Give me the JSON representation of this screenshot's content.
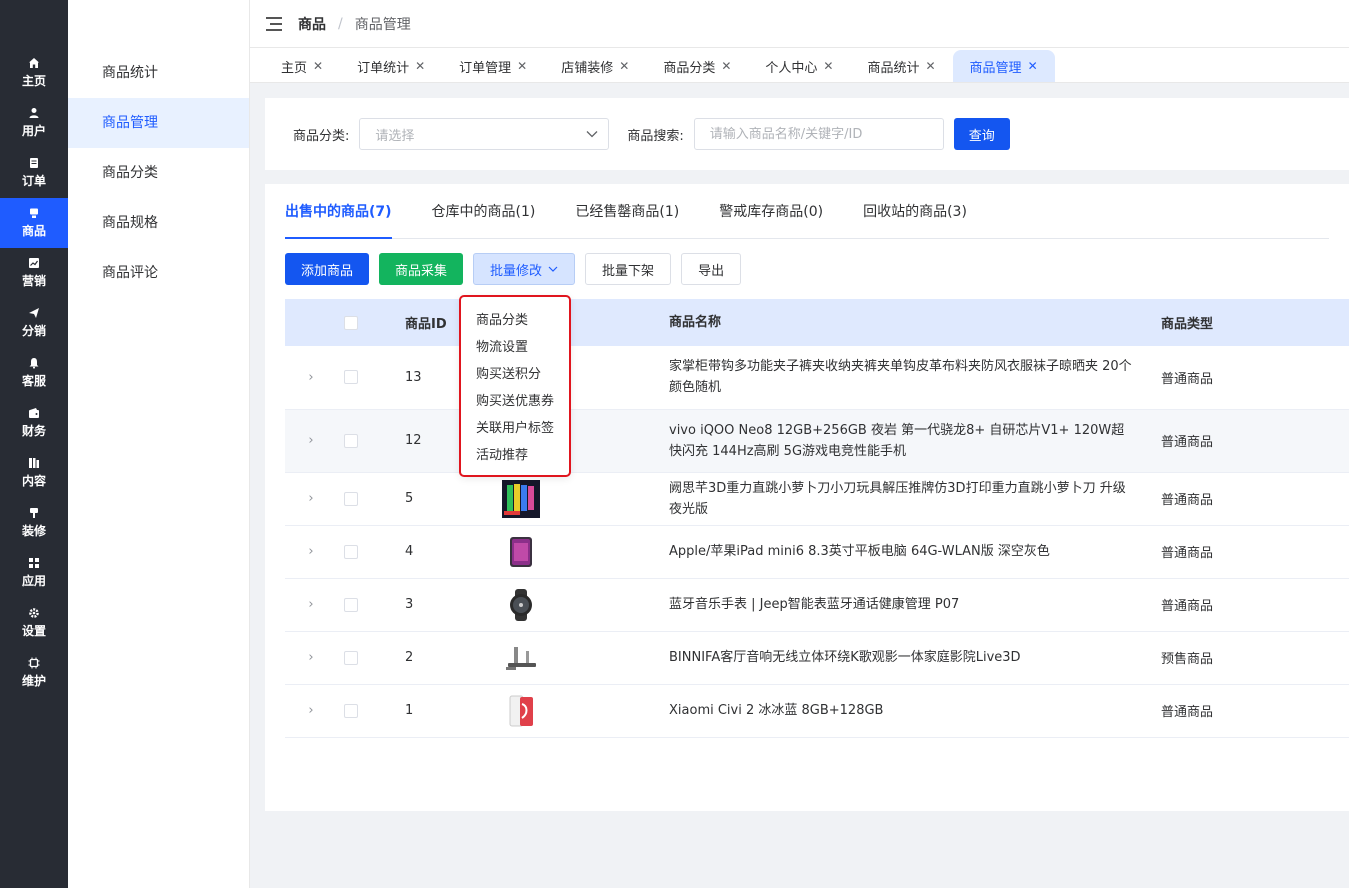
{
  "rail": [
    {
      "label": "主页",
      "icon": "home-icon"
    },
    {
      "label": "用户",
      "icon": "user-icon"
    },
    {
      "label": "订单",
      "icon": "order-icon"
    },
    {
      "label": "商品",
      "icon": "goods-icon",
      "active": true
    },
    {
      "label": "营销",
      "icon": "chart-icon"
    },
    {
      "label": "分销",
      "icon": "send-icon"
    },
    {
      "label": "客服",
      "icon": "bell-icon"
    },
    {
      "label": "财务",
      "icon": "wallet-icon"
    },
    {
      "label": "内容",
      "icon": "content-icon"
    },
    {
      "label": "装修",
      "icon": "brush-icon"
    },
    {
      "label": "应用",
      "icon": "grid-icon"
    },
    {
      "label": "设置",
      "icon": "gear-icon"
    },
    {
      "label": "维护",
      "icon": "chip-icon"
    }
  ],
  "submenu": [
    "商品统计",
    "商品管理",
    "商品分类",
    "商品规格",
    "商品评论"
  ],
  "breadcrumb": {
    "root": "商品",
    "current": "商品管理"
  },
  "tabs": [
    "主页",
    "订单统计",
    "订单管理",
    "店铺装修",
    "商品分类",
    "个人中心",
    "商品统计",
    "商品管理"
  ],
  "filter": {
    "category_label": "商品分类:",
    "category_placeholder": "请选择",
    "search_label": "商品搜索:",
    "search_placeholder": "请输入商品名称/关键字/ID",
    "query_button": "查询"
  },
  "status_tabs": [
    "出售中的商品(7)",
    "仓库中的商品(1)",
    "已经售罄商品(1)",
    "警戒库存商品(0)",
    "回收站的商品(3)"
  ],
  "toolbar": {
    "add": "添加商品",
    "collect": "商品采集",
    "batch_edit": "批量修改",
    "batch_off": "批量下架",
    "export": "导出"
  },
  "table": {
    "headers": {
      "id": "商品ID",
      "name": "商品名称",
      "type": "商品类型"
    },
    "rows": [
      {
        "id": "13",
        "name": "家掌柜带钩多功能夹子裤夹收纳夹裤夹单钩皮革布料夹防风衣服袜子晾晒夹 20个颜色随机",
        "type": "普通商品",
        "thumb": "none"
      },
      {
        "id": "12",
        "name": "vivo iQOO Neo8 12GB+256GB 夜岩 第一代骁龙8+ 自研芯片V1+ 120W超快闪充 144Hz高刷 5G游戏电竞性能手机",
        "type": "普通商品",
        "thumb": "none"
      },
      {
        "id": "5",
        "name": "阙思芊3D重力直跳小萝卜刀小刀玩具解压推牌仿3D打印重力直跳小萝卜刀 升级夜光版",
        "type": "普通商品",
        "thumb": "toy-knife-thumb"
      },
      {
        "id": "4",
        "name": "Apple/苹果iPad mini6 8.3英寸平板电脑 64G-WLAN版 深空灰色",
        "type": "普通商品",
        "thumb": "ipad-thumb"
      },
      {
        "id": "3",
        "name": "蓝牙音乐手表 | Jeep智能表蓝牙通话健康管理 P07",
        "type": "普通商品",
        "thumb": "watch-thumb"
      },
      {
        "id": "2",
        "name": "BINNIFA客厅音响无线立体环绕K歌观影一体家庭影院Live3D",
        "type": "预售商品",
        "thumb": "speaker-thumb"
      },
      {
        "id": "1",
        "name": "Xiaomi Civi 2 冰冰蓝 8GB+128GB",
        "type": "普通商品",
        "thumb": "phone-thumb"
      }
    ]
  },
  "dropdown": [
    "商品分类",
    "物流设置",
    "购买送积分",
    "购买送优惠券",
    "关联用户标签",
    "活动推荐"
  ]
}
